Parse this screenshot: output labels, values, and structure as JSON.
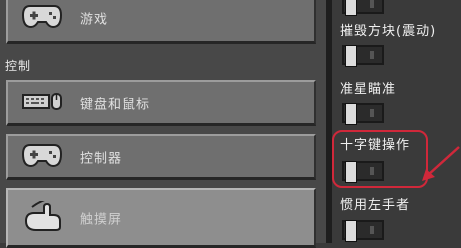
{
  "left_panel": {
    "games_label": "游戏",
    "section_title": "控制",
    "keyboard_label": "键盘和鼠标",
    "controller_label": "控制器",
    "touch_label": "触摸屏"
  },
  "right_panel": {
    "options": [
      {
        "label": "",
        "enabled": false
      },
      {
        "label": "摧毁方块(震动)",
        "enabled": false
      },
      {
        "label": "准星瞄准",
        "enabled": false
      },
      {
        "label": "十字键操作",
        "enabled": false
      },
      {
        "label": "惯用左手者",
        "enabled": false
      }
    ]
  },
  "annotation": {
    "color": "#d0283a"
  },
  "icons": [
    "gamepad-icon",
    "keyboard-mouse-icon",
    "gamepad-icon",
    "touch-hand-icon",
    "red-arrow-icon"
  ]
}
